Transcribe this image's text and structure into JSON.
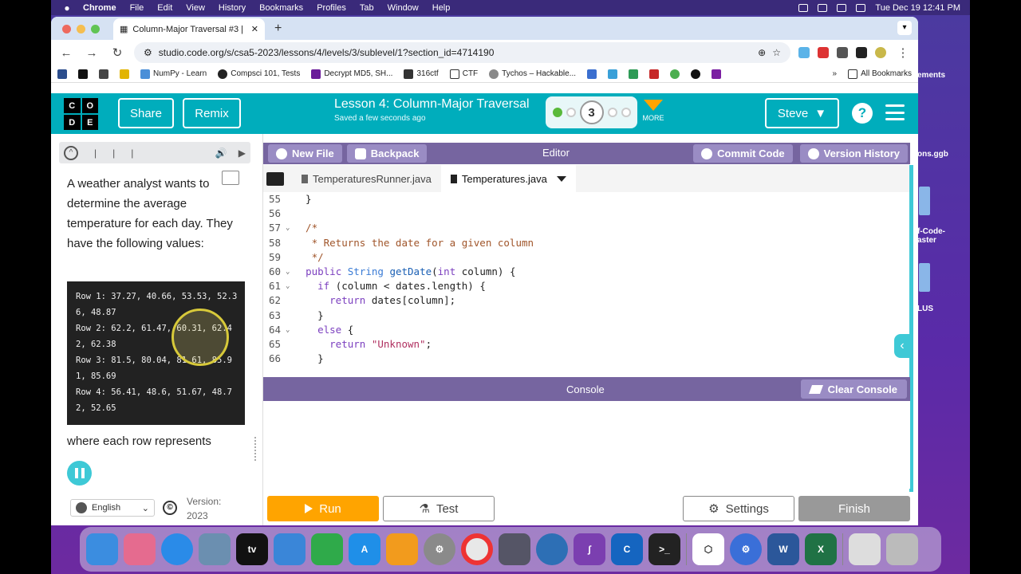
{
  "menubar": {
    "items": [
      "Chrome",
      "File",
      "Edit",
      "View",
      "History",
      "Bookmarks",
      "Profiles",
      "Tab",
      "Window",
      "Help"
    ],
    "datetime": "Tue Dec 19  12:41 PM"
  },
  "desktop": {
    "labels": [
      "ements",
      "ons.ggb",
      "f-Code-\naster",
      "LUS"
    ]
  },
  "browser": {
    "tab_title": "Column-Major Traversal #3 | ",
    "url": "studio.code.org/s/csa5-2023/lessons/4/levels/3/sublevel/1?section_id=4714190",
    "bookmarks": [
      "NumPy - Learn",
      "Compsci 101, Tests",
      "Decrypt MD5, SH...",
      "316ctf",
      "CTF",
      "Tychos – Hackable...",
      "All Bookmarks"
    ]
  },
  "header": {
    "logo_letters": [
      "C",
      "O",
      "D",
      "E"
    ],
    "share_label": "Share",
    "remix_label": "Remix",
    "lesson_title": "Lesson 4: Column-Major Traversal",
    "saved_text": "Saved a few seconds ago",
    "current_level": "3",
    "more_label": "MORE",
    "user_name": "Steve",
    "help_label": "?"
  },
  "instructions": {
    "text": "A weather analyst wants to determine the average temperature for each day. They have the following values:",
    "rows": [
      "Row 1: 37.27, 40.66, 53.53, 52.36, 48.87",
      "Row 2: 62.2, 61.47, 60.31, 62.42, 62.38",
      "Row 3: 81.5, 80.04, 81.61, 85.91, 85.69",
      "Row 4: 56.41, 48.6, 51.67, 48.72, 52.65"
    ],
    "text_after": "where each row represents",
    "language": "English",
    "copyright_symbol": "©",
    "version_label": "Version:",
    "version_value": "2023"
  },
  "editor": {
    "new_file_label": "New File",
    "backpack_label": "Backpack",
    "editor_label": "Editor",
    "commit_label": "Commit Code",
    "version_history_label": "Version History",
    "files": [
      "TemperaturesRunner.java",
      "Temperatures.java"
    ],
    "active_file": "Temperatures.java",
    "line_numbers": [
      "55",
      "56",
      "57",
      "58",
      "59",
      "60",
      "61",
      "62",
      "63",
      "64",
      "65",
      "66"
    ],
    "console_label": "Console",
    "clear_console_label": "Clear Console"
  },
  "bottom": {
    "run_label": "Run",
    "test_label": "Test",
    "settings_label": "Settings",
    "finish_label": "Finish"
  },
  "colors": {
    "header_teal": "#00adbc",
    "editor_purple": "#7665a0",
    "run_orange": "#ffa400"
  }
}
